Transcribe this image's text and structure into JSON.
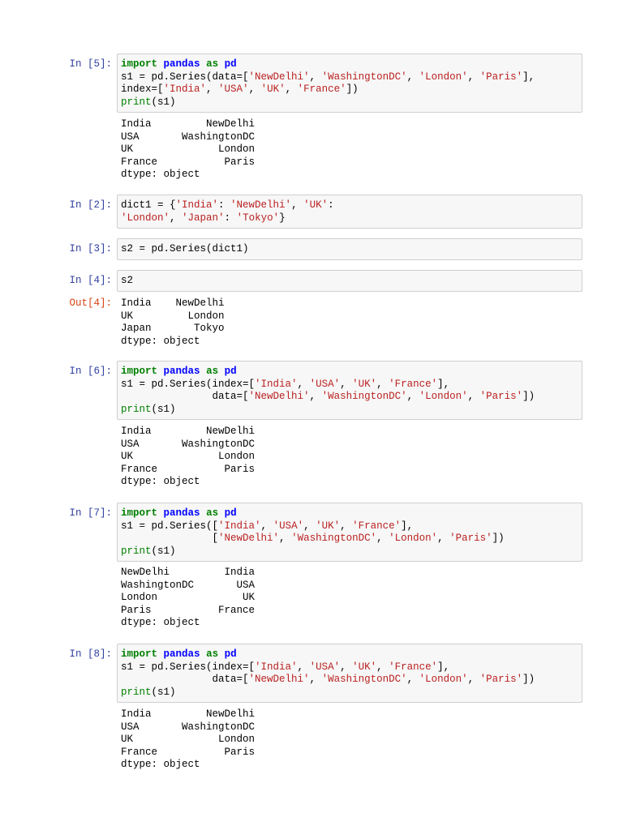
{
  "cells": [
    {
      "prompt": "In [5]:",
      "code": [
        [
          [
            "kw",
            "import"
          ],
          [
            "t",
            " "
          ],
          [
            "mod",
            "pandas"
          ],
          [
            "t",
            " "
          ],
          [
            "kw",
            "as"
          ],
          [
            "t",
            " "
          ],
          [
            "mod",
            "pd"
          ]
        ],
        [
          [
            "t",
            "s1 = pd.Series(data=["
          ],
          [
            "str",
            "'NewDelhi'"
          ],
          [
            "t",
            ", "
          ],
          [
            "str",
            "'WashingtonDC'"
          ],
          [
            "t",
            ", "
          ],
          [
            "str",
            "'London'"
          ],
          [
            "t",
            ", "
          ],
          [
            "str",
            "'Paris'"
          ],
          [
            "t",
            "],"
          ]
        ],
        [
          [
            "t",
            "index=["
          ],
          [
            "str",
            "'India'"
          ],
          [
            "t",
            ", "
          ],
          [
            "str",
            "'USA'"
          ],
          [
            "t",
            ", "
          ],
          [
            "str",
            "'UK'"
          ],
          [
            "t",
            ", "
          ],
          [
            "str",
            "'France'"
          ],
          [
            "t",
            "])"
          ]
        ],
        [
          [
            "bi",
            "print"
          ],
          [
            "t",
            "(s1)"
          ]
        ]
      ],
      "output_prompt": "",
      "output": [
        "India         NewDelhi",
        "USA       WashingtonDC",
        "UK              London",
        "France           Paris",
        "dtype: object"
      ]
    },
    {
      "prompt": "In [2]:",
      "code": [
        [
          [
            "t",
            "dict1 = {"
          ],
          [
            "str",
            "'India'"
          ],
          [
            "t",
            ": "
          ],
          [
            "str",
            "'NewDelhi'"
          ],
          [
            "t",
            ", "
          ],
          [
            "str",
            "'UK'"
          ],
          [
            "t",
            ":"
          ]
        ],
        [
          [
            "str",
            "'London'"
          ],
          [
            "t",
            ", "
          ],
          [
            "str",
            "'Japan'"
          ],
          [
            "t",
            ": "
          ],
          [
            "str",
            "'Tokyo'"
          ],
          [
            "t",
            "}"
          ]
        ]
      ],
      "output_prompt": "",
      "output": []
    },
    {
      "prompt": "In [3]:",
      "code": [
        [
          [
            "t",
            "s2 = pd.Series(dict1)"
          ]
        ]
      ],
      "output_prompt": "",
      "output": []
    },
    {
      "prompt": "In [4]:",
      "code": [
        [
          [
            "t",
            "s2"
          ]
        ]
      ],
      "output_prompt": "Out[4]:",
      "output": [
        "India    NewDelhi",
        "UK         London",
        "Japan       Tokyo",
        "dtype: object"
      ]
    },
    {
      "prompt": "In [6]:",
      "code": [
        [
          [
            "kw",
            "import"
          ],
          [
            "t",
            " "
          ],
          [
            "mod",
            "pandas"
          ],
          [
            "t",
            " "
          ],
          [
            "kw",
            "as"
          ],
          [
            "t",
            " "
          ],
          [
            "mod",
            "pd"
          ]
        ],
        [
          [
            "t",
            "s1 = pd.Series(index=["
          ],
          [
            "str",
            "'India'"
          ],
          [
            "t",
            ", "
          ],
          [
            "str",
            "'USA'"
          ],
          [
            "t",
            ", "
          ],
          [
            "str",
            "'UK'"
          ],
          [
            "t",
            ", "
          ],
          [
            "str",
            "'France'"
          ],
          [
            "t",
            "],"
          ]
        ],
        [
          [
            "t",
            "               data=["
          ],
          [
            "str",
            "'NewDelhi'"
          ],
          [
            "t",
            ", "
          ],
          [
            "str",
            "'WashingtonDC'"
          ],
          [
            "t",
            ", "
          ],
          [
            "str",
            "'London'"
          ],
          [
            "t",
            ", "
          ],
          [
            "str",
            "'Paris'"
          ],
          [
            "t",
            "])"
          ]
        ],
        [
          [
            "bi",
            "print"
          ],
          [
            "t",
            "(s1)"
          ]
        ]
      ],
      "output_prompt": "",
      "output": [
        "India         NewDelhi",
        "USA       WashingtonDC",
        "UK              London",
        "France           Paris",
        "dtype: object"
      ]
    },
    {
      "prompt": "In [7]:",
      "code": [
        [
          [
            "kw",
            "import"
          ],
          [
            "t",
            " "
          ],
          [
            "mod",
            "pandas"
          ],
          [
            "t",
            " "
          ],
          [
            "kw",
            "as"
          ],
          [
            "t",
            " "
          ],
          [
            "mod",
            "pd"
          ]
        ],
        [
          [
            "t",
            "s1 = pd.Series(["
          ],
          [
            "str",
            "'India'"
          ],
          [
            "t",
            ", "
          ],
          [
            "str",
            "'USA'"
          ],
          [
            "t",
            ", "
          ],
          [
            "str",
            "'UK'"
          ],
          [
            "t",
            ", "
          ],
          [
            "str",
            "'France'"
          ],
          [
            "t",
            "],"
          ]
        ],
        [
          [
            "t",
            "               ["
          ],
          [
            "str",
            "'NewDelhi'"
          ],
          [
            "t",
            ", "
          ],
          [
            "str",
            "'WashingtonDC'"
          ],
          [
            "t",
            ", "
          ],
          [
            "str",
            "'London'"
          ],
          [
            "t",
            ", "
          ],
          [
            "str",
            "'Paris'"
          ],
          [
            "t",
            "])"
          ]
        ],
        [
          [
            "bi",
            "print"
          ],
          [
            "t",
            "(s1)"
          ]
        ]
      ],
      "output_prompt": "",
      "output": [
        "NewDelhi         India",
        "WashingtonDC       USA",
        "London              UK",
        "Paris           France",
        "dtype: object"
      ]
    },
    {
      "prompt": "In [8]:",
      "code": [
        [
          [
            "kw",
            "import"
          ],
          [
            "t",
            " "
          ],
          [
            "mod",
            "pandas"
          ],
          [
            "t",
            " "
          ],
          [
            "kw",
            "as"
          ],
          [
            "t",
            " "
          ],
          [
            "mod",
            "pd"
          ]
        ],
        [
          [
            "t",
            "s1 = pd.Series(index=["
          ],
          [
            "str",
            "'India'"
          ],
          [
            "t",
            ", "
          ],
          [
            "str",
            "'USA'"
          ],
          [
            "t",
            ", "
          ],
          [
            "str",
            "'UK'"
          ],
          [
            "t",
            ", "
          ],
          [
            "str",
            "'France'"
          ],
          [
            "t",
            "],"
          ]
        ],
        [
          [
            "t",
            "               data=["
          ],
          [
            "str",
            "'NewDelhi'"
          ],
          [
            "t",
            ", "
          ],
          [
            "str",
            "'WashingtonDC'"
          ],
          [
            "t",
            ", "
          ],
          [
            "str",
            "'London'"
          ],
          [
            "t",
            ", "
          ],
          [
            "str",
            "'Paris'"
          ],
          [
            "t",
            "])"
          ]
        ],
        [
          [
            "bi",
            "print"
          ],
          [
            "t",
            "(s1)"
          ]
        ]
      ],
      "output_prompt": "",
      "output": [
        "India         NewDelhi",
        "USA       WashingtonDC",
        "UK              London",
        "France           Paris",
        "dtype: object"
      ]
    }
  ]
}
